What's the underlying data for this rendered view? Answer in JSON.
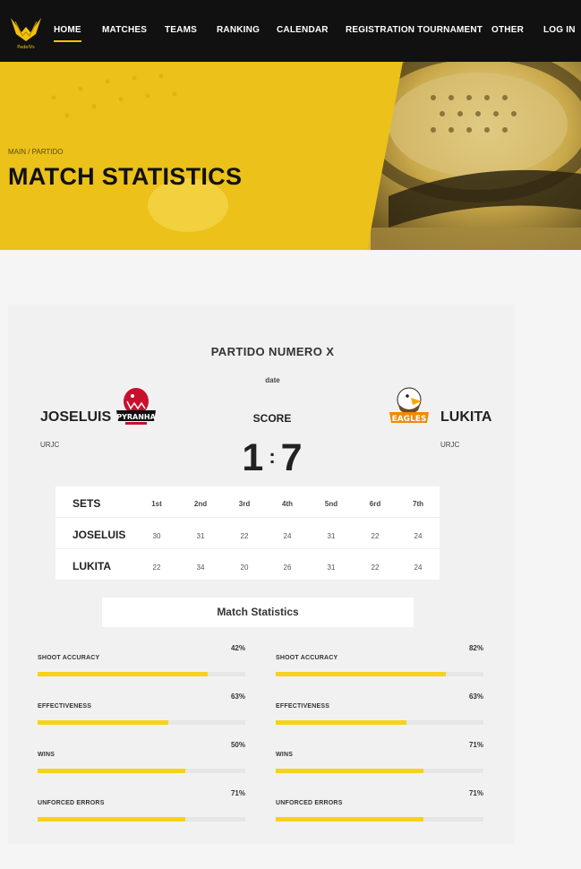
{
  "brand": {
    "logo_text": "PadelVs"
  },
  "nav": {
    "items": [
      "HOME",
      "MATCHES",
      "TEAMS",
      "RANKING",
      "CALENDAR",
      "REGISTRATION TOURNAMENT",
      "OTHER",
      "LOG IN"
    ],
    "active": "HOME"
  },
  "hero": {
    "breadcrumb": "MAIN / PARTIDO",
    "title": "MATCH STATISTICS"
  },
  "match": {
    "title": "PARTIDO NUMERO X",
    "date": "date",
    "score_label": "SCORE",
    "score_home": "1",
    "score_sep": ":",
    "score_away": "7",
    "home": {
      "name": "JOSELUIS",
      "org": "URJC",
      "logo": "piranha-logo"
    },
    "away": {
      "name": "LUKITA",
      "org": "URJC",
      "logo": "eagles-logo"
    }
  },
  "sets": {
    "header": "SETS",
    "columns": [
      "1st",
      "2nd",
      "3rd",
      "4th",
      "5nd",
      "6rd",
      "7th"
    ],
    "rows": [
      {
        "name": "JOSELUIS",
        "values": [
          "30",
          "31",
          "22",
          "24",
          "31",
          "22",
          "24"
        ]
      },
      {
        "name": "LUKITA",
        "values": [
          "22",
          "34",
          "20",
          "26",
          "31",
          "22",
          "24"
        ]
      }
    ]
  },
  "stats": {
    "title": "Match Statistics",
    "home": [
      {
        "label": "SHOOT ACCURACY",
        "value": "42%",
        "fill": 0.82
      },
      {
        "label": "EFFECTIVENESS",
        "value": "63%",
        "fill": 0.63
      },
      {
        "label": "WINS",
        "value": "50%",
        "fill": 0.71
      },
      {
        "label": "UNFORCED ERRORS",
        "value": "71%",
        "fill": 0.71
      }
    ],
    "away": [
      {
        "label": "SHOOT ACCURACY",
        "value": "82%",
        "fill": 0.82
      },
      {
        "label": "EFFECTIVENESS",
        "value": "63%",
        "fill": 0.63
      },
      {
        "label": "WINS",
        "value": "71%",
        "fill": 0.71
      },
      {
        "label": "UNFORCED ERRORS",
        "value": "71%",
        "fill": 0.71
      }
    ]
  },
  "colors": {
    "accent": "#f4c20d",
    "nav_bg": "#111111",
    "bar": "#f7d21a"
  }
}
